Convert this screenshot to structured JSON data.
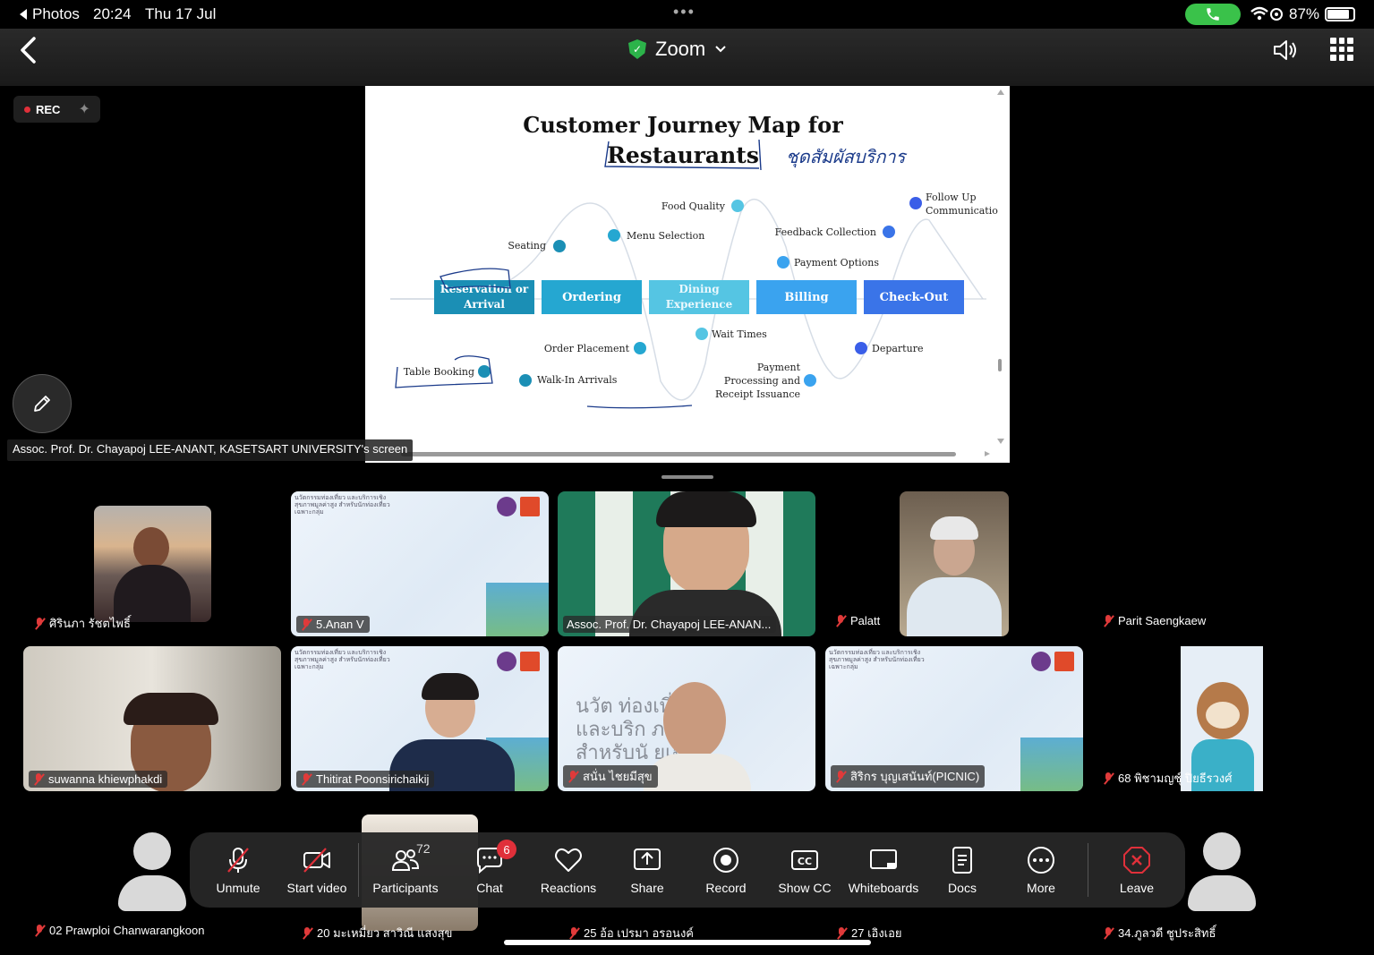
{
  "status_bar": {
    "back_app": "Photos",
    "time": "20:24",
    "date": "Thu 17 Jul",
    "battery": "87%"
  },
  "top_bar": {
    "title": "Zoom",
    "accent_color": "#2cb34a"
  },
  "rec_label": "REC",
  "shared_screen": {
    "owner_label": "Assoc. Prof. Dr. Chayapoj LEE-ANANT, KASETSART UNIVERSITY's screen",
    "slide": {
      "title_line1": "Customer Journey Map for",
      "title_line2": "Restaurants",
      "handwriting": "ชุดสัมผัสบริการ",
      "stages": [
        "Reservation or Arrival",
        "Ordering",
        "Dining Experience",
        "Billing",
        "Check-Out"
      ],
      "touchpoints_above": [
        "Seating",
        "Menu Selection",
        "Food Quality",
        "Payment Options",
        "Feedback Collection",
        "Follow Up Communicatio"
      ],
      "touchpoints_below": [
        "Table Booking",
        "Walk-In Arrivals",
        "Order Placement",
        "Wait Times",
        "Payment Processing and Receipt Issuance",
        "Departure"
      ]
    }
  },
  "participants": {
    "row1": [
      "ศิรินภา รัชตไพธิ์",
      "5.Anan V",
      "Assoc. Prof. Dr. Chayapoj LEE-ANAN...",
      "Palatt",
      "Parit Saengkaew"
    ],
    "row2": [
      "suwanna khiewphakdi",
      "Thitirat Poonsirichaikij",
      "สนั่น ไชยมีสุข",
      "สิริกร บุญเสนันท์(PICNIC)",
      "68 พิชามญชุ์ ปิยธีรวงศ์"
    ],
    "row3": [
      "02 Prawploi Chanwarangkoon",
      "20 มะเหมี่ยว สาวิณี แสงสุข",
      "25 อ้อ เปรมา อรอนงค์",
      "27 เอิงเอย",
      "34.ภูลวดี ชูประสิทธิ์"
    ],
    "slide_caption": "นวัตกรรมท่องเที่ยว และบริการเชิงสุขภาพมูลค่าสูง สำหรับนักท่องเที่ยวเฉพาะกลุ่ม"
  },
  "toolbar": {
    "unmute": "Unmute",
    "start_video": "Start video",
    "participants": "Participants",
    "participants_count": "72",
    "chat": "Chat",
    "chat_badge": "6",
    "reactions": "Reactions",
    "share": "Share",
    "record": "Record",
    "show_cc": "Show CC",
    "whiteboards": "Whiteboards",
    "docs": "Docs",
    "more": "More",
    "leave": "Leave"
  }
}
